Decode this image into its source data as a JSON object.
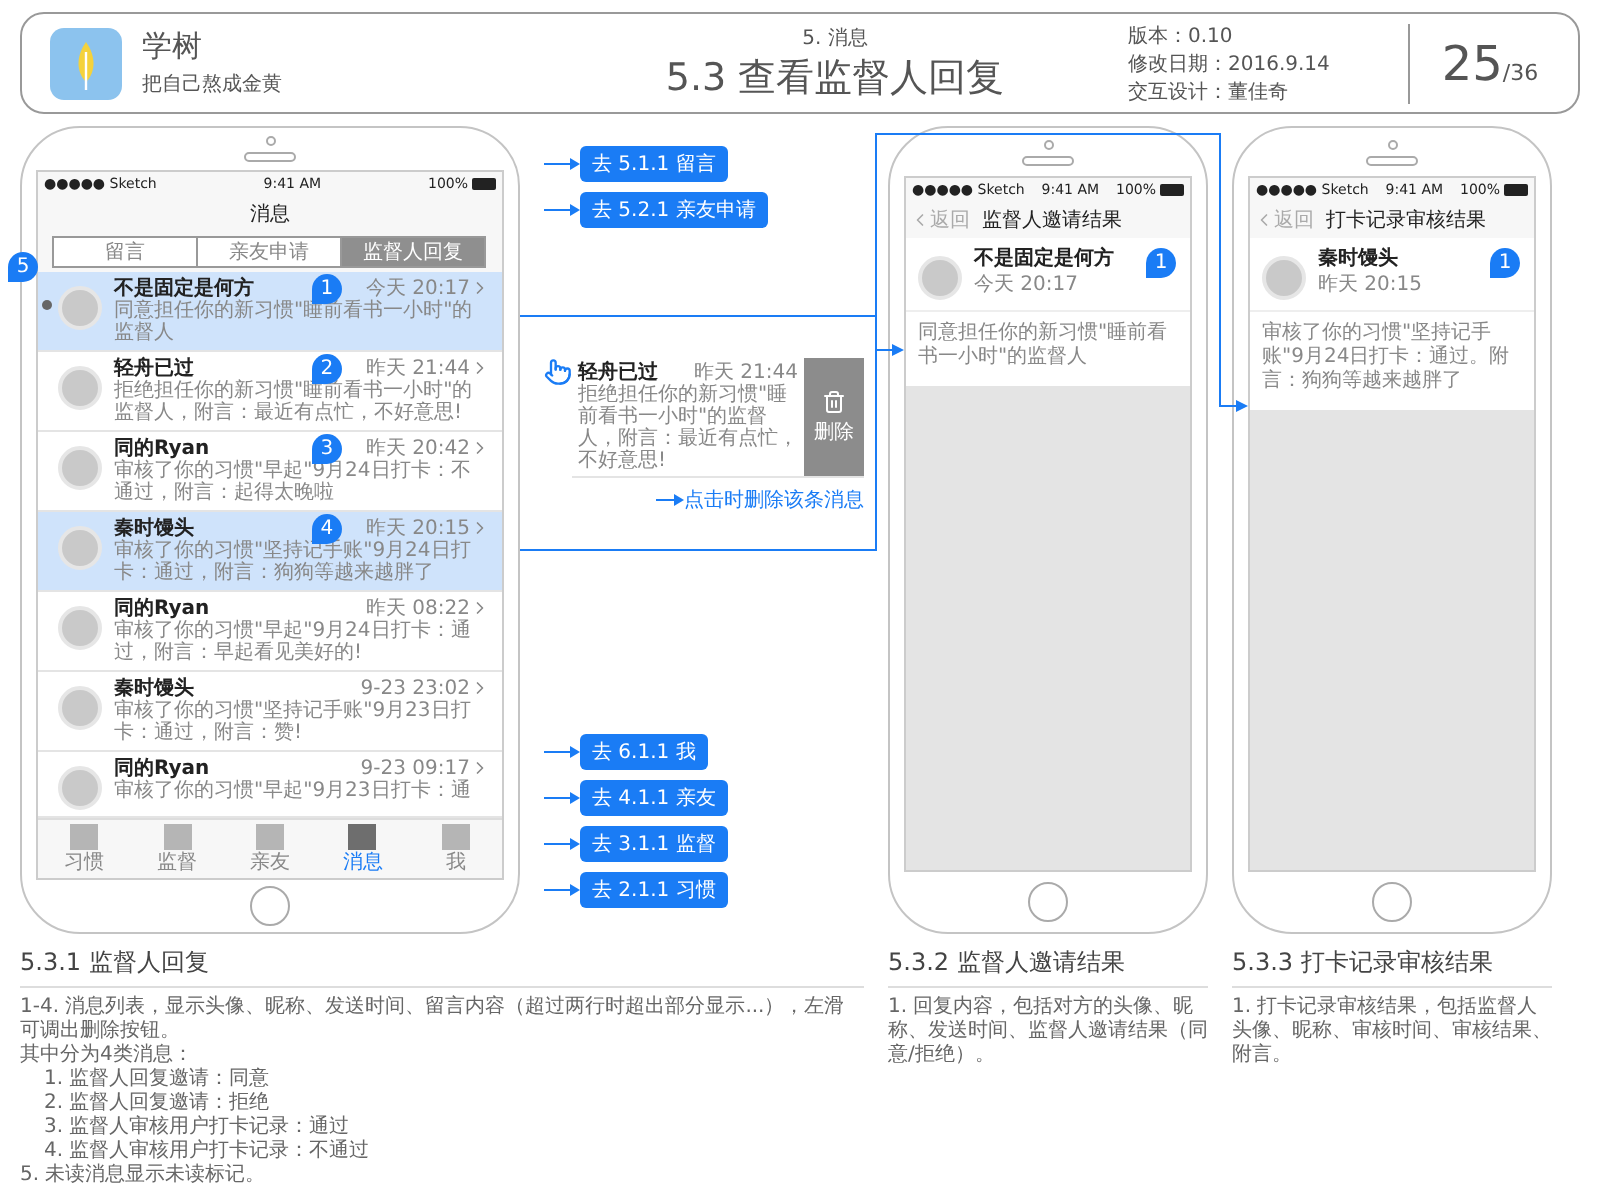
{
  "header": {
    "app_name": "学树",
    "slogan": "把自己熬成金黄",
    "section": "5. 消息",
    "title": "5.3 查看监督人回复",
    "version": "版本：0.10",
    "modified": "修改日期：2016.9.14",
    "designer": "交互设计：董佳奇",
    "page": "25",
    "total": "/36"
  },
  "phone_list": {
    "status_bar": {
      "carrier": "●●●●● Sketch",
      "time": "9:41 AM",
      "battery": "100%"
    },
    "title": "消息",
    "unread_marker": "5",
    "segments": [
      {
        "label": "留言",
        "selected": false
      },
      {
        "label": "亲友申请",
        "selected": false
      },
      {
        "label": "监督人回复",
        "selected": true
      }
    ],
    "messages": [
      {
        "name": "不是固定是何方",
        "time": "今天 20:17",
        "preview": "同意担任你的新习惯\"睡前看书一小时\"的监督人",
        "unread": true,
        "highlighted": true,
        "marker": "1"
      },
      {
        "name": "轻舟已过",
        "time": "昨天 21:44",
        "preview": "拒绝担任你的新习惯\"睡前看书一小时\"的监督人，附言：最近有点忙，不好意思!",
        "unread": false,
        "highlighted": false,
        "marker": "2"
      },
      {
        "name": "同的Ryan",
        "time": "昨天 20:42",
        "preview": "审核了你的习惯\"早起\"9月24日打卡：不通过，附言：起得太晚啦",
        "unread": false,
        "highlighted": false,
        "marker": "3"
      },
      {
        "name": "秦时馒头",
        "time": "昨天 20:15",
        "preview": "审核了你的习惯\"坚持记手账\"9月24日打卡：通过，附言：狗狗等越来越胖了",
        "unread": false,
        "highlighted": true,
        "marker": "4"
      },
      {
        "name": "同的Ryan",
        "time": "昨天 08:22",
        "preview": "审核了你的习惯\"早起\"9月24日打卡：通过，附言：早起看见美好的!",
        "unread": false,
        "highlighted": false
      },
      {
        "name": "秦时馒头",
        "time": "9-23 23:02",
        "preview": "审核了你的习惯\"坚持记手账\"9月23日打卡：通过，附言：赞!",
        "unread": false,
        "highlighted": false
      },
      {
        "name": "同的Ryan",
        "time": "9-23 09:17",
        "preview": "审核了你的习惯\"早起\"9月23日打卡：通",
        "unread": false,
        "highlighted": false
      }
    ],
    "tab_bar": [
      {
        "label": "习惯",
        "selected": false
      },
      {
        "label": "监督",
        "selected": false
      },
      {
        "label": "亲友",
        "selected": false
      },
      {
        "label": "消息",
        "selected": true
      },
      {
        "label": "我",
        "selected": false
      }
    ]
  },
  "callouts": {
    "top": [
      "去 5.1.1 留言",
      "去 5.2.1 亲友申请"
    ],
    "bottom": [
      "去 6.1.1 我",
      "去 4.1.1 亲友",
      "去 3.1.1 监督",
      "去 2.1.1 习惯"
    ]
  },
  "swipe_demo": {
    "name": "轻舟已过",
    "time": "昨天 21:44",
    "preview": "拒绝担任你的新习惯\"睡前看书一小时\"的监督人，附言：最近有点忙，不好意思!",
    "delete_label": "删除",
    "note": "点击时删除该条消息"
  },
  "detail_screens": [
    {
      "status_bar": {
        "carrier": "●●●●● Sketch",
        "time": "9:41 AM",
        "battery": "100%"
      },
      "back": "返回",
      "title": "监督人邀请结果",
      "name": "不是固定是何方",
      "time": "今天 20:17",
      "marker": "1",
      "content": "同意担任你的新习惯\"睡前看书一小时\"的监督人"
    },
    {
      "status_bar": {
        "carrier": "●●●●● Sketch",
        "time": "9:41 AM",
        "battery": "100%"
      },
      "back": "返回",
      "title": "打卡记录审核结果",
      "name": "秦时馒头",
      "time": "昨天 20:15",
      "marker": "1",
      "content": "审核了你的习惯\"坚持记手账\"9月24日打卡：通过。附言：狗狗等越来越胖了"
    }
  ],
  "descriptions": [
    {
      "title": "5.3.1 监督人回复",
      "lines": [
        {
          "text": "1-4. 消息列表，显示头像、昵称、发送时间、留言内容（超过两行时超出部分显示...），左滑可调出删除按钮。",
          "indented": false
        },
        {
          "text": "其中分为4类消息：",
          "indented": false
        },
        {
          "text": "1. 监督人回复邀请：同意",
          "indented": true
        },
        {
          "text": "2. 监督人回复邀请：拒绝",
          "indented": true
        },
        {
          "text": "3. 监督人审核用户打卡记录：通过",
          "indented": true
        },
        {
          "text": "4. 监督人审核用户打卡记录：不通过",
          "indented": true
        },
        {
          "text": "5. 未读消息显示未读标记。",
          "indented": false
        }
      ]
    },
    {
      "title": "5.3.2 监督人邀请结果",
      "lines": [
        {
          "text": "1. 回复内容，包括对方的头像、昵称、发送时间、监督人邀请结果（同意/拒绝）。",
          "indented": false
        }
      ]
    },
    {
      "title": "5.3.3 打卡记录审核结果",
      "lines": [
        {
          "text": "1. 打卡记录审核结果，包括监督人头像、昵称、审核时间、审核结果、附言。",
          "indented": false
        }
      ]
    }
  ]
}
